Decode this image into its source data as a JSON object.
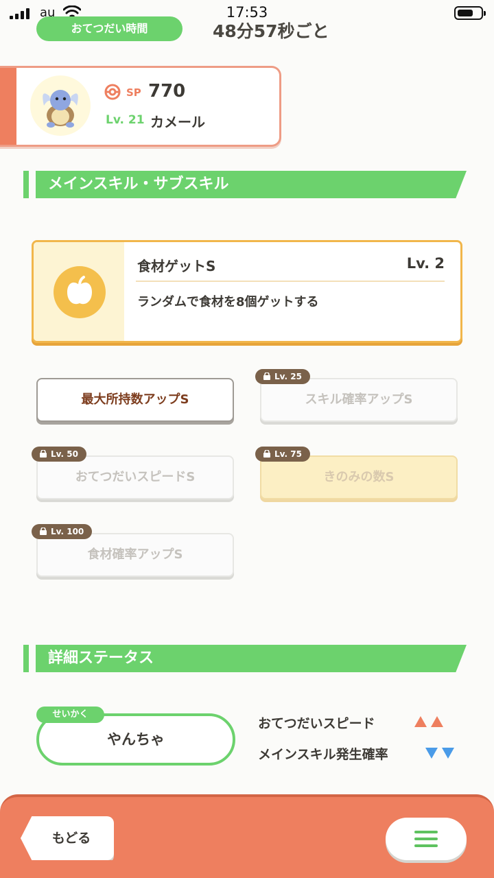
{
  "status_bar": {
    "carrier": "au",
    "time": "17:53"
  },
  "help_time": {
    "label": "おてつだい時間",
    "value": "48分57秒ごと"
  },
  "pokemon": {
    "sp_label": "SP",
    "sp_value": "770",
    "level": "Lv. 21",
    "name": "カメール"
  },
  "skills_section": {
    "title": "メインスキル・サブスキル"
  },
  "main_skill": {
    "name": "食材ゲットS",
    "level": "Lv. 2",
    "description": "ランダムで食材を8個ゲットする",
    "icon": "apple-icon"
  },
  "sub_skills": [
    {
      "label": "最大所持数アップS",
      "lock": ""
    },
    {
      "label": "スキル確率アップS",
      "lock": "Lv. 25"
    },
    {
      "label": "おてつだいスピードS",
      "lock": "Lv. 50"
    },
    {
      "label": "きのみの数S",
      "lock": "Lv. 75"
    },
    {
      "label": "食材確率アップS",
      "lock": "Lv. 100"
    }
  ],
  "details_section": {
    "title": "詳細ステータス"
  },
  "nature": {
    "tag": "せいかく",
    "value": "やんちゃ",
    "up_stat": "おてつだいスピード",
    "down_stat": "メインスキル発生確率"
  },
  "footer": {
    "back_label": "もどる",
    "menu_icon": "hamburger-menu-icon"
  },
  "colors": {
    "green": "#6cd26d",
    "coral": "#ee7f5f",
    "gold": "#f1b64b",
    "up": "#ee7f5f",
    "down": "#4a9be8"
  }
}
